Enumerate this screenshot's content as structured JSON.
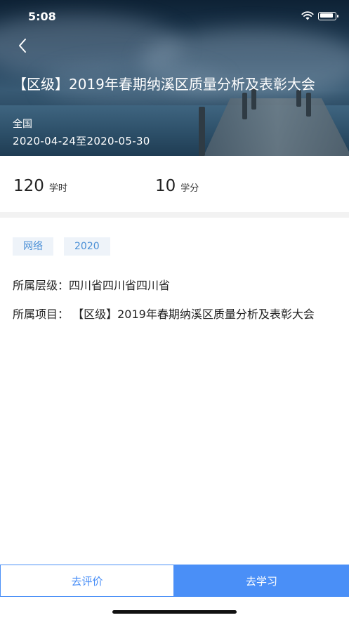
{
  "status_bar": {
    "time": "5:08"
  },
  "header": {
    "back_icon": "chevron-left-icon",
    "title": "【区级】2019年春期纳溪区质量分析及表彰大会",
    "scope": "全国",
    "date_range": "2020-04-24至2020-05-30"
  },
  "stats": {
    "hours_value": "120",
    "hours_unit": "学时",
    "credits_value": "10",
    "credits_unit": "学分"
  },
  "tags": [
    "网络",
    "2020"
  ],
  "info": {
    "level_label": "所属层级：",
    "level_value": "四川省四川省四川省",
    "project_label": "所属项目：",
    "project_value": "【区级】2019年春期纳溪区质量分析及表彰大会"
  },
  "actions": {
    "evaluate_label": "去评价",
    "study_label": "去学习"
  },
  "colors": {
    "accent": "#4a8ff7",
    "tag_text": "#4a8fd6",
    "tag_bg": "#eef3f9"
  }
}
